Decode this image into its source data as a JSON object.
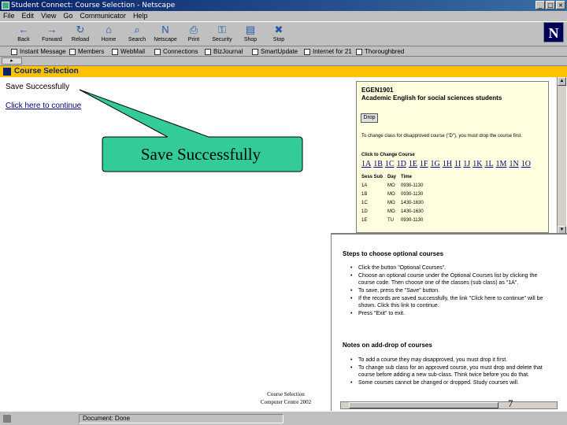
{
  "window": {
    "title": "Student Connect: Course Selection - Netscape",
    "controls": [
      "_",
      "□",
      "×"
    ]
  },
  "menu": [
    "File",
    "Edit",
    "View",
    "Go",
    "Communicator",
    "Help"
  ],
  "toolbar": [
    {
      "label": "Back",
      "icon": "back-arrow-icon",
      "glyph": "←"
    },
    {
      "label": "Forward",
      "icon": "forward-arrow-icon",
      "glyph": "→"
    },
    {
      "label": "Reload",
      "icon": "reload-icon",
      "glyph": "↻"
    },
    {
      "label": "Home",
      "icon": "home-icon",
      "glyph": "⌂"
    },
    {
      "label": "Search",
      "icon": "search-icon",
      "glyph": "⌕"
    },
    {
      "label": "Netscape",
      "icon": "netscape-icon",
      "glyph": "N"
    },
    {
      "label": "Print",
      "icon": "print-icon",
      "glyph": "⎙"
    },
    {
      "label": "Security",
      "icon": "security-icon",
      "glyph": "⚿"
    },
    {
      "label": "Shop",
      "icon": "shop-icon",
      "glyph": "▤"
    },
    {
      "label": "Stop",
      "icon": "stop-icon",
      "glyph": "✖"
    }
  ],
  "personal_bar": [
    "Instant Message",
    "Members",
    "WebMail",
    "Connections",
    "BizJournal",
    "SmartUpdate",
    "Internet for 21",
    "Thoroughbred"
  ],
  "banner": {
    "title": "Course Selection"
  },
  "main": {
    "save_message": "Save Successfully",
    "continue_link": "Click here to continue"
  },
  "callout": {
    "text": "Save Successfully"
  },
  "course_panel": {
    "code": "EGEN1901",
    "name": "Academic English for social sciences students",
    "drop_button": "Drop",
    "drop_note": "To change class for disapproved course (\"D\"), you must drop the course first.",
    "change_heading": "Click to Change Course",
    "subclasses": [
      "1A",
      "1B",
      "1C",
      "1D",
      "1E",
      "1F",
      "1G",
      "1H",
      "1I",
      "1J",
      "1K",
      "1L",
      "1M",
      "1N",
      "1O"
    ],
    "schedule_headers": [
      "Sess Sub",
      "Day",
      "Time"
    ],
    "schedule_rows": [
      [
        "1A",
        "MO",
        "0930-1130"
      ],
      [
        "1B",
        "MO",
        "0930-1130"
      ],
      [
        "1C",
        "MO",
        "1430-1630"
      ],
      [
        "1D",
        "MO",
        "1430-1630"
      ],
      [
        "1E",
        "TU",
        "0930-1130"
      ]
    ]
  },
  "steps_panel": {
    "steps_heading": "Steps to choose optional courses",
    "steps": [
      "Click the button \"Optional Courses\".",
      "Choose an optional course under the Optional Courses list by clicking the course code. Then choose one of the classes (sub class) as \"1A\".",
      "To save, press the \"Save\" button.",
      "If the records are saved successfully, the link \"Click here to continue\" will be shown. Click this link to continue.",
      "Press \"Exit\" to exit."
    ],
    "notes_heading": "Notes on add-drop of courses",
    "notes": [
      "To add a course they may disapproved, you must drop it first.",
      "To change sub class for an approved course, you must drop and delete that course before adding a new sub-class. Think twice before you do that.",
      "Some courses cannot be changed or dropped. Study courses will."
    ]
  },
  "footer": {
    "line1": "Course Selection",
    "line2": "Computer Centre 2002"
  },
  "status": {
    "text": "Document: Done"
  },
  "page_number": "7",
  "colors": {
    "banner": "#ffc000",
    "callout_fill": "#33cc99",
    "titlebar": "#0a246a"
  }
}
